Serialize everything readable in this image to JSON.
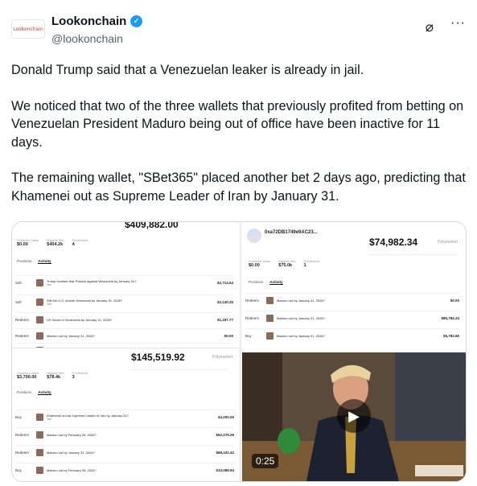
{
  "author": {
    "logo_text": "Lookonchain",
    "display_name": "Lookonchain",
    "handle": "@lookonchain",
    "verified_icon": "verified-badge-icon",
    "accent": "#1d9bf0"
  },
  "tweet": {
    "paragraphs": [
      "Donald Trump said that a Venezuelan leaker is already in jail.",
      "We noticed that two of the three wallets that previously profited from betting on Venezuelan President Maduro being out of office have been inactive for 11 days.",
      "The remaining wallet, \"SBet365\" placed another bet 2 days ago, predicting that Khamenei out as Supreme Leader of Iran by January 31."
    ]
  },
  "media": {
    "panel_a": {
      "top_value": "$409,882.00",
      "stats": [
        {
          "label": "Positions Value",
          "value": "$0.00"
        },
        {
          "label": "Biggest Win",
          "value": "$404.2k"
        },
        {
          "label": "Predictions",
          "value": "4"
        }
      ],
      "tabs": [
        "Positions",
        "Activity"
      ],
      "rows": [
        {
          "type": "Sell",
          "market": "Trump Invokes War Powers against Venezuela by January 31?",
          "sub": "Yes",
          "amount": "$2,714.64"
        },
        {
          "type": "Sell",
          "market": "Will the U.S. invade Venezuela by January 31, 2026?",
          "sub": "Yes",
          "amount": "$3,140.26"
        },
        {
          "type": "Redeem",
          "market": "US forces in Venezuela by January 31, 2026?",
          "sub": "",
          "amount": "$1,197.77"
        },
        {
          "type": "Redeem",
          "market": "Maduro out by January 31, 2026?",
          "sub": "",
          "amount": "$0.00"
        },
        {
          "type": "Redeem",
          "market": "Maduro out by January 31, 2026?",
          "sub": "",
          "amount": "$0.00"
        }
      ],
      "second_big_value": "$145,519.92",
      "polymarket_label": "Polymarket",
      "second_stats": [
        {
          "label": "Positions Value",
          "value": "$3,700.00"
        },
        {
          "label": "Biggest Win",
          "value": "$78.4k"
        },
        {
          "label": "Predictions",
          "value": "3"
        }
      ],
      "second_rows": [
        {
          "type": "Buy",
          "market": "Khamenei out as Supreme Leader of Iran by January 31?",
          "sub": "Yes",
          "amount": "$4,000.00"
        },
        {
          "type": "Redeem",
          "market": "Maduro out by February 28, 2026?",
          "sub": "",
          "amount": "$62,276.26"
        },
        {
          "type": "Redeem",
          "market": "Maduro out by January 31, 2026?",
          "sub": "",
          "amount": "$88,432.42"
        },
        {
          "type": "Buy",
          "market": "Maduro out by February 28, 2026?",
          "sub": "",
          "amount": "$10,089.94"
        }
      ]
    },
    "panel_b": {
      "wallet": "0xa72DB1749e9AC23...",
      "big_value": "$74,982.34",
      "polymarket_label": "Polymarket",
      "stats": [
        {
          "label": "Positions Value",
          "value": "$0.00"
        },
        {
          "label": "Biggest Win",
          "value": "$75.0k"
        },
        {
          "label": "Predictions",
          "value": "1"
        }
      ],
      "tabs": [
        "Positions",
        "Activity"
      ],
      "rows": [
        {
          "type": "Redeem",
          "market": "Maduro out by January 31, 2026?",
          "amount": "$0.00"
        },
        {
          "type": "Redeem",
          "market": "Maduro out by January 31, 2026?",
          "amount": "$85,784.34"
        },
        {
          "type": "Buy",
          "market": "Maduro out by January 31, 2026?",
          "amount": "$5,782.66"
        }
      ]
    },
    "video": {
      "duration": "0:25",
      "play_icon": "play-icon"
    }
  }
}
